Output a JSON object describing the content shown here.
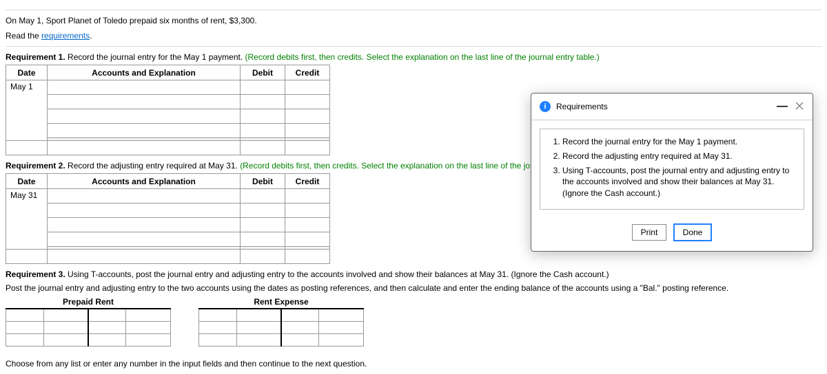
{
  "problem": {
    "intro": "On May 1, Sport Planet of Toledo prepaid six months of rent, $3,300.",
    "read_prefix": "Read the ",
    "requirements_link": "requirements",
    "read_suffix": "."
  },
  "req1": {
    "label": "Requirement 1.",
    "text": " Record the journal entry for the May 1 payment. ",
    "instr": "(Record debits first, then credits. Select the explanation on the last line of the journal entry table.)",
    "date_header": "Date",
    "acct_header": "Accounts and Explanation",
    "debit_header": "Debit",
    "credit_header": "Credit",
    "date_value": "May 1"
  },
  "req2": {
    "label": "Requirement 2.",
    "text": " Record the adjusting entry required at May 31. ",
    "instr": "(Record debits first, then credits. Select the explanation on the last line of the journal entry table.)",
    "date_header": "Date",
    "acct_header": "Accounts and Explanation",
    "debit_header": "Debit",
    "credit_header": "Credit",
    "date_value": "May 31"
  },
  "req3": {
    "label": "Requirement 3.",
    "text": " Using T-accounts, post the journal entry and adjusting entry to the accounts involved and show their balances at May 31. (Ignore the Cash account.)",
    "subtext": "Post the journal entry and adjusting entry to the two accounts using the dates as posting references, and then calculate and enter the ending balance of the accounts using a \"Bal.\" posting reference.",
    "tacct1": "Prepaid Rent",
    "tacct2": "Rent Expense"
  },
  "popup": {
    "title": "Requirements",
    "items": [
      "Record the journal entry for the May 1 payment.",
      "Record the adjusting entry required at May 31.",
      "Using T-accounts, post the journal entry and adjusting entry to the accounts involved and show their balances at May 31. (Ignore the Cash account.)"
    ],
    "print": "Print",
    "done": "Done",
    "minimize": "—",
    "info": "i"
  },
  "footer": "Choose from any list or enter any number in the input fields and then continue to the next question."
}
